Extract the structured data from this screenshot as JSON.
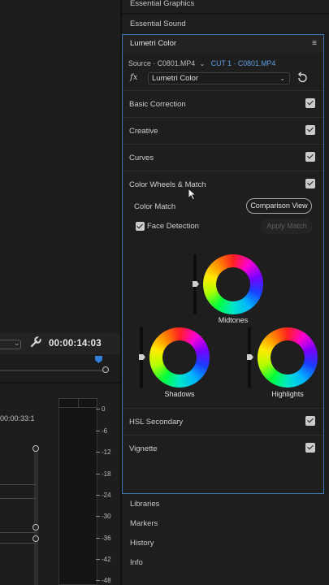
{
  "panels": {
    "essential_graphics": "Essential Graphics",
    "essential_sound": "Essential Sound",
    "libraries": "Libraries",
    "markers": "Markers",
    "history": "History",
    "info": "Info"
  },
  "lumetri": {
    "title": "Lumetri Color",
    "source_label": "Source · C0801.MP4",
    "clip_label": "CUT 1 · C0801.MP4",
    "fx_label": "fx",
    "effect_select": "Lumetri Color",
    "sections": [
      {
        "label": "Basic Correction",
        "checked": true
      },
      {
        "label": "Creative",
        "checked": true
      },
      {
        "label": "Curves",
        "checked": true
      },
      {
        "label": "Color Wheels & Match",
        "checked": true
      },
      {
        "label": "HSL Secondary",
        "checked": true
      },
      {
        "label": "Vignette",
        "checked": true
      }
    ],
    "color_match_label": "Color Match",
    "comparison_view_button": "Comparison View",
    "face_detection_label": "Face Detection",
    "face_detection_checked": true,
    "apply_match_button": "Apply Match",
    "wheels": {
      "midtones": "Midtones",
      "shadows": "Shadows",
      "highlights": "Highlights"
    }
  },
  "timeline": {
    "timecode": "00:00:14:03",
    "timecode2": "00:00:33:1"
  },
  "audio_meter": {
    "scale": [
      "0",
      "-6",
      "-12",
      "-18",
      "-24",
      "-30",
      "-36",
      "-42",
      "-48"
    ]
  }
}
